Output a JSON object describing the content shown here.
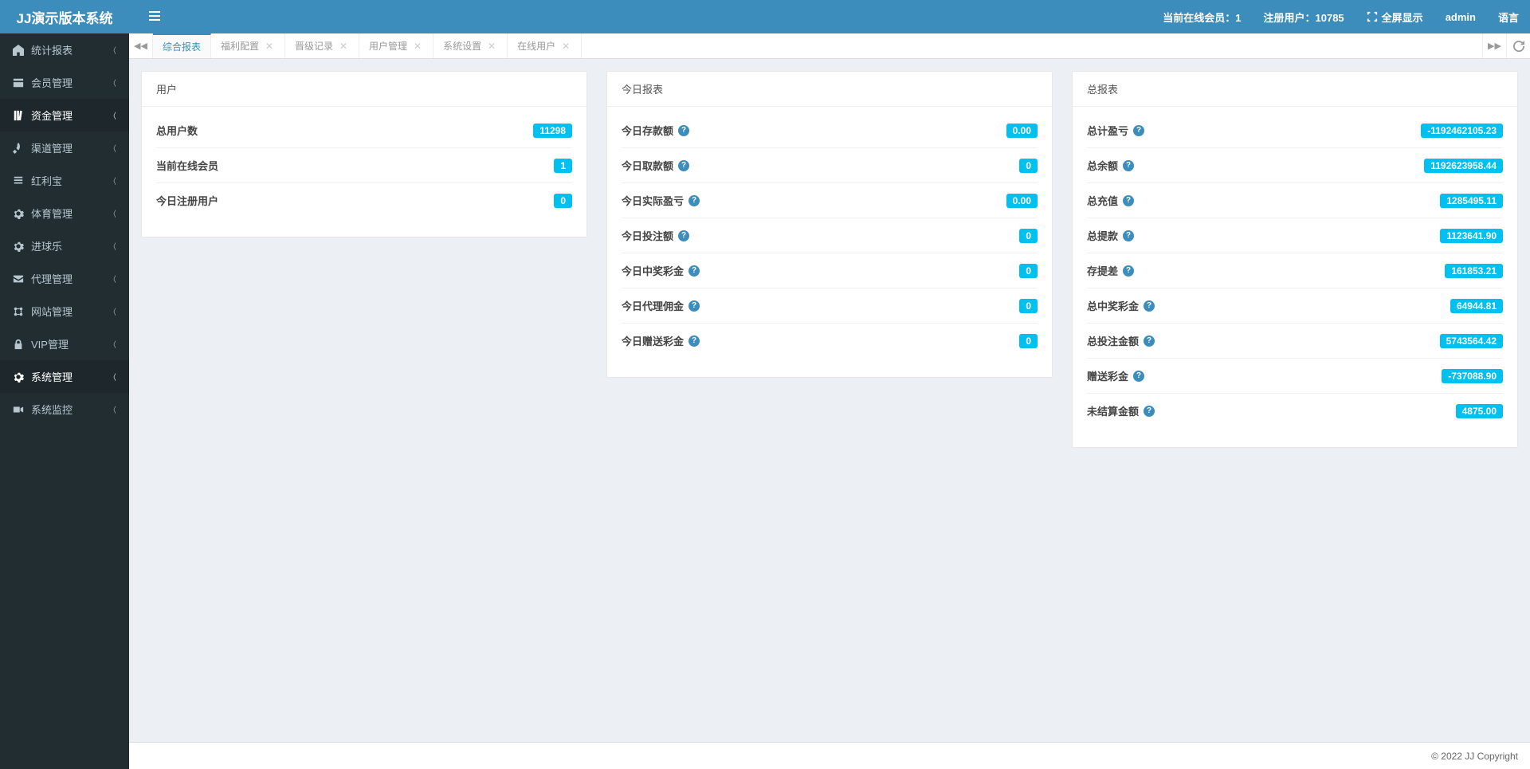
{
  "app": {
    "title": "JJ演示版本系统"
  },
  "header": {
    "online_label": "当前在线会员：1",
    "registered_label": "注册用户：10785",
    "fullscreen_label": "全屏显示",
    "user_label": "admin",
    "lang_label": "语言"
  },
  "sidebar": {
    "items": [
      {
        "label": "统计报表",
        "icon": "dashboard"
      },
      {
        "label": "会员管理",
        "icon": "window"
      },
      {
        "label": "资金管理",
        "icon": "book",
        "active": true
      },
      {
        "label": "渠道管理",
        "icon": "rocket"
      },
      {
        "label": "红利宝",
        "icon": "list"
      },
      {
        "label": "体育管理",
        "icon": "gear"
      },
      {
        "label": "进球乐",
        "icon": "gear"
      },
      {
        "label": "代理管理",
        "icon": "mail"
      },
      {
        "label": "网站管理",
        "icon": "settings"
      },
      {
        "label": "VIP管理",
        "icon": "lock"
      },
      {
        "label": "系统管理",
        "icon": "gear",
        "active": true
      },
      {
        "label": "系统监控",
        "icon": "camera"
      }
    ]
  },
  "tabs": [
    {
      "label": "综合报表",
      "closable": false,
      "active": true
    },
    {
      "label": "福利配置",
      "closable": true
    },
    {
      "label": "晋级记录",
      "closable": true
    },
    {
      "label": "用户管理",
      "closable": true
    },
    {
      "label": "系统设置",
      "closable": true
    },
    {
      "label": "在线用户",
      "closable": true
    }
  ],
  "panels": {
    "user": {
      "title": "用户",
      "rows": [
        {
          "label": "总用户数",
          "value": "11298",
          "help": false
        },
        {
          "label": "当前在线会员",
          "value": "1",
          "help": false
        },
        {
          "label": "今日注册用户",
          "value": "0",
          "help": false
        }
      ]
    },
    "today": {
      "title": "今日报表",
      "rows": [
        {
          "label": "今日存款额",
          "value": "0.00",
          "help": true
        },
        {
          "label": "今日取款额",
          "value": "0",
          "help": true
        },
        {
          "label": "今日实际盈亏",
          "value": "0.00",
          "help": true
        },
        {
          "label": "今日投注额",
          "value": "0",
          "help": true
        },
        {
          "label": "今日中奖彩金",
          "value": "0",
          "help": true
        },
        {
          "label": "今日代理佣金",
          "value": "0",
          "help": true
        },
        {
          "label": "今日赠送彩金",
          "value": "0",
          "help": true
        }
      ]
    },
    "total": {
      "title": "总报表",
      "rows": [
        {
          "label": "总计盈亏",
          "value": "-1192462105.23",
          "help": true
        },
        {
          "label": "总余额",
          "value": "1192623958.44",
          "help": true
        },
        {
          "label": "总充值",
          "value": "1285495.11",
          "help": true
        },
        {
          "label": "总提款",
          "value": "1123641.90",
          "help": true
        },
        {
          "label": "存提差",
          "value": "161853.21",
          "help": true
        },
        {
          "label": "总中奖彩金",
          "value": "64944.81",
          "help": true
        },
        {
          "label": "总投注金额",
          "value": "5743564.42",
          "help": true
        },
        {
          "label": "赠送彩金",
          "value": "-737088.90",
          "help": true
        },
        {
          "label": "未结算金额",
          "value": "4875.00",
          "help": true
        }
      ]
    }
  },
  "footer": {
    "copyright": "© 2022 JJ Copyright"
  }
}
